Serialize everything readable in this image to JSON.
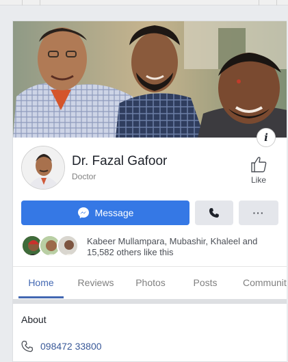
{
  "page": {
    "name": "Dr. Fazal Gafoor",
    "category": "Doctor"
  },
  "actions": {
    "like_label": "Like",
    "message_label": "Message",
    "more_label": "···",
    "info_label": "i"
  },
  "friends": {
    "text": "Kabeer Mullampara, Mubashir, Khaleel and 15,582 others like this"
  },
  "tabs": [
    {
      "label": "Home",
      "active": true
    },
    {
      "label": "Reviews",
      "active": false
    },
    {
      "label": "Photos",
      "active": false
    },
    {
      "label": "Posts",
      "active": false
    },
    {
      "label": "Community",
      "active": false
    }
  ],
  "about": {
    "title": "About",
    "phone": "098472 33800"
  },
  "colors": {
    "accent": "#4267b2",
    "message_button": "#3578e5",
    "link": "#385898"
  },
  "icons": {
    "like": "thumbs-up-icon",
    "messenger": "messenger-icon",
    "call": "phone-icon",
    "phone": "phone-outline-icon",
    "info": "info-icon"
  }
}
